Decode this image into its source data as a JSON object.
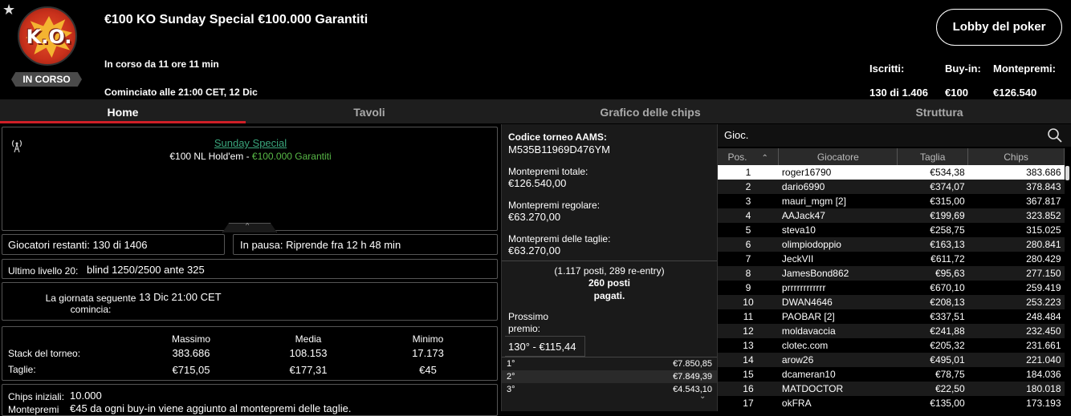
{
  "header": {
    "logo_text": "K.O.",
    "status_badge": "IN CORSO",
    "title": "€100 KO Sunday Special €100.000 Garantiti",
    "running_text": "In corso da 11 ore 11 min",
    "started_text": "Cominciato alle 21:00 CET, 12 Dic",
    "lobby_button": "Lobby del poker",
    "stats": {
      "registered_label": "Iscritti:",
      "registered_value": "130 di 1.406",
      "buyin_label": "Buy-in:",
      "buyin_value": "€100",
      "prize_label": "Montepremi:",
      "prize_value": "€126.540"
    }
  },
  "tabs": [
    {
      "label": "Home",
      "active": true
    },
    {
      "label": "Tavoli",
      "active": false
    },
    {
      "label": "Grafico delle chips",
      "active": false
    },
    {
      "label": "Struttura",
      "active": false
    }
  ],
  "info": {
    "link": "Sunday Special",
    "game": "€100 NL Hold'em - ",
    "guarantee": "€100.000 Garantiti",
    "players_left": "Giocatori restanti: 130 di 1406",
    "pause": "In pausa: Riprende fra 12 h 48 min",
    "last_level_label": "Ultimo livello 20:",
    "last_level_value": "blind 1250/2500 ante 325",
    "next_day_label": "La giornata seguente comincia:",
    "next_day_value": "13 Dic 21:00 CET",
    "stack_headers": [
      "Massimo",
      "Media",
      "Minimo"
    ],
    "stack_label": "Stack del torneo:",
    "stack_values": [
      "383.686",
      "108.153",
      "17.173"
    ],
    "bounty_label": "Taglie:",
    "bounty_values": [
      "€715,05",
      "€177,31",
      "€45"
    ],
    "initial_chips_label": "Chips iniziali:",
    "initial_chips_value": "10.000",
    "prizepool_label": "Montepremi",
    "prizepool_text": "€45 da ogni buy-in viene aggiunto al montepremi delle taglie."
  },
  "mid": {
    "aams_label": "Codice torneo AAMS:",
    "aams_code": "M535B11969D476YM",
    "total_label": "Montepremi totale:",
    "total_value": "€126.540,00",
    "regular_label": "Montepremi regolare:",
    "regular_value": "€63.270,00",
    "bounty_label": "Montepremi delle taglie:",
    "bounty_value": "€63.270,00",
    "seats_line1": "(1.117 posti, 289 re-entry)",
    "seats_line2": "260 posti",
    "seats_line3": "pagati.",
    "next_prize_label": "Prossimo premio:",
    "next_prize_value": "130° - €115,44",
    "payouts": [
      {
        "pos": "1°",
        "amount": "€7.850,85"
      },
      {
        "pos": "2°",
        "amount": "€7.849,39"
      },
      {
        "pos": "3°",
        "amount": "€4.543,10"
      }
    ]
  },
  "players": {
    "search_label": "Gioc.",
    "columns": [
      "Pos.",
      "Giocatore",
      "Taglia",
      "Chips"
    ],
    "rows": [
      {
        "pos": "1",
        "name": "roger16790",
        "bounty": "€534,38",
        "chips": "383.686"
      },
      {
        "pos": "2",
        "name": "dario6990",
        "bounty": "€374,07",
        "chips": "378.843"
      },
      {
        "pos": "3",
        "name": "mauri_mgm [2]",
        "bounty": "€315,00",
        "chips": "367.817"
      },
      {
        "pos": "4",
        "name": "AAJack47",
        "bounty": "€199,69",
        "chips": "323.852"
      },
      {
        "pos": "5",
        "name": "steva10",
        "bounty": "€258,75",
        "chips": "315.025"
      },
      {
        "pos": "6",
        "name": "olimpiodoppio",
        "bounty": "€163,13",
        "chips": "280.841"
      },
      {
        "pos": "7",
        "name": "JeckVII",
        "bounty": "€611,72",
        "chips": "280.429"
      },
      {
        "pos": "8",
        "name": "JamesBond862",
        "bounty": "€95,63",
        "chips": "277.150"
      },
      {
        "pos": "9",
        "name": "prrrrrrrrrrrr",
        "bounty": "€670,10",
        "chips": "259.419"
      },
      {
        "pos": "10",
        "name": "DWAN4646",
        "bounty": "€208,13",
        "chips": "253.223"
      },
      {
        "pos": "11",
        "name": "PAOBAR [2]",
        "bounty": "€337,51",
        "chips": "248.484"
      },
      {
        "pos": "12",
        "name": "moldavaccia",
        "bounty": "€241,88",
        "chips": "232.450"
      },
      {
        "pos": "13",
        "name": "clotec.com",
        "bounty": "€205,32",
        "chips": "231.661"
      },
      {
        "pos": "14",
        "name": "arow26",
        "bounty": "€495,01",
        "chips": "221.040"
      },
      {
        "pos": "15",
        "name": "dcameran10",
        "bounty": "€78,75",
        "chips": "184.036"
      },
      {
        "pos": "16",
        "name": "MATDOCTOR",
        "bounty": "€22,50",
        "chips": "180.018"
      },
      {
        "pos": "17",
        "name": "okFRA",
        "bounty": "€135,00",
        "chips": "173.193"
      }
    ]
  },
  "colors": {
    "accent_red": "#d01f27",
    "link_green": "#3aa67c",
    "guarantee_green": "#58b947"
  }
}
